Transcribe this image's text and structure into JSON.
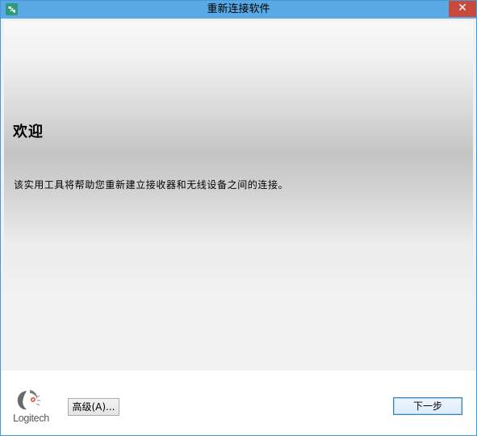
{
  "window": {
    "title": "重新连接软件",
    "close_symbol": "✕",
    "app_icon": "logitech-connect-icon"
  },
  "main": {
    "heading": "欢迎",
    "description": "该实用工具将帮助您重新建立接收器和无线设备之间的连接。"
  },
  "footer": {
    "logo_text": "Logitech",
    "advanced_label": "高级(A)...",
    "next_label": "下一步"
  },
  "colors": {
    "titlebar": "#5aa9e4",
    "close_button": "#c74a3d",
    "window_border": "#3f9bd6"
  }
}
